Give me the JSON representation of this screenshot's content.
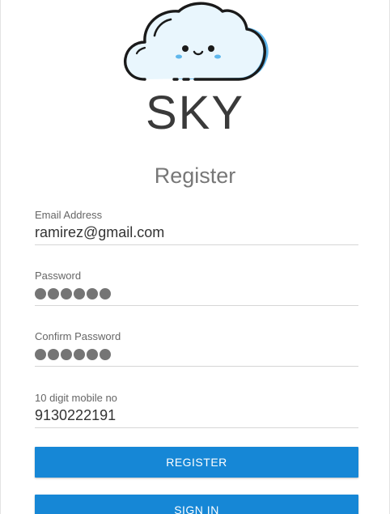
{
  "app": {
    "brand": "SKY",
    "logo_icon": "cloud-smiley-icon"
  },
  "form": {
    "title": "Register",
    "email": {
      "label": "Email Address",
      "value": "ramirez@gmail.com"
    },
    "password": {
      "label": "Password",
      "mask_length": 6
    },
    "confirm_password": {
      "label": "Confirm Password",
      "mask_length": 6
    },
    "mobile": {
      "label": "10 digit mobile no",
      "value": "9130222191"
    }
  },
  "actions": {
    "register_label": "REGISTER",
    "sign_in_label": "SIGN IN"
  },
  "colors": {
    "primary": "#1687d6",
    "cloud_fill": "#e9f6fd",
    "cloud_shadow": "#5fb7ec",
    "outline": "#1a1a1a"
  }
}
